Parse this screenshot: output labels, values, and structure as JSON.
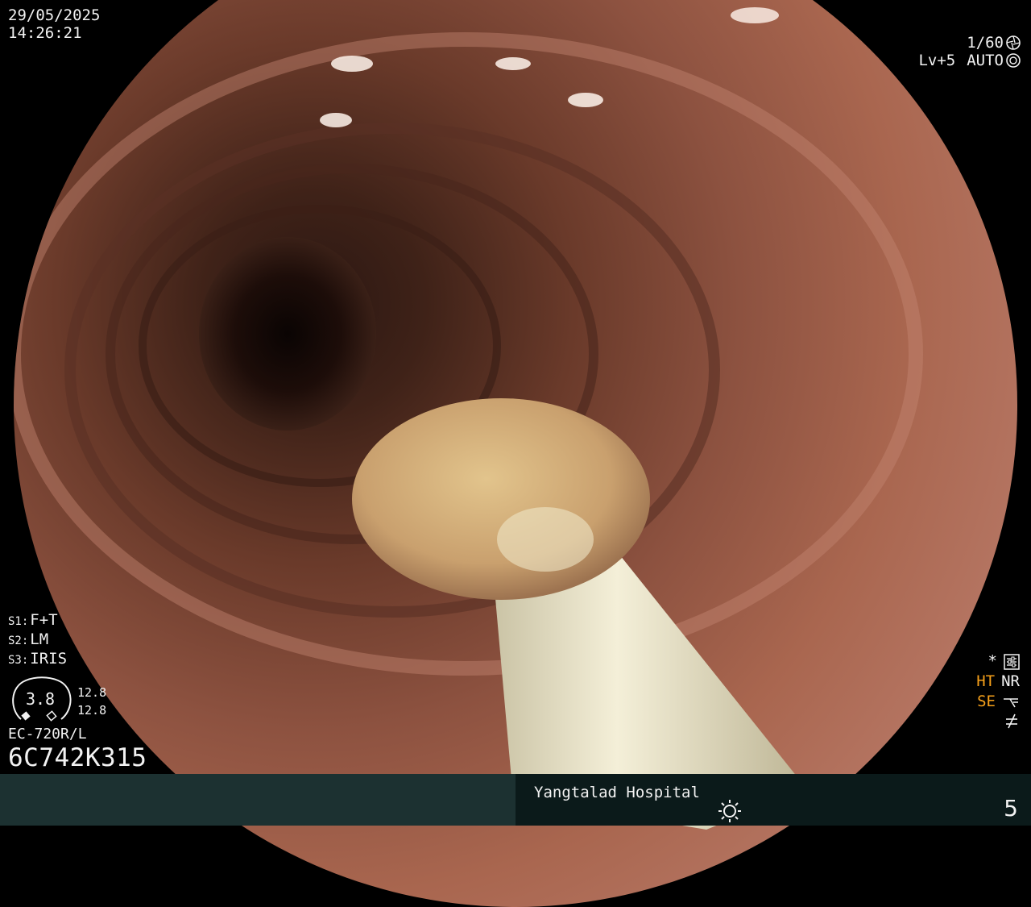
{
  "overlay": {
    "date": "29/05/2025",
    "time": "14:26:21",
    "shutter": "1/60",
    "level": "Lv+5",
    "mode": "AUTO"
  },
  "settings": [
    {
      "key": "S1:",
      "value": "F+T"
    },
    {
      "key": "S2:",
      "value": "LM"
    },
    {
      "key": "S3:",
      "value": "IRIS"
    }
  ],
  "gauge": {
    "center": "3.8",
    "top": "12.8",
    "bottom": "12.8"
  },
  "scope": {
    "model": "EC-720R/L",
    "serial": "6C742K315"
  },
  "status_icons": {
    "star": "*",
    "ht": "HT",
    "nr": "NR",
    "se": "SE"
  },
  "footer": {
    "hospital": "Yangtalad Hospital",
    "page": "5"
  },
  "colors": {
    "orange": "#f6a01a",
    "bar": "#0b1a1a",
    "bar_left": "#1c3131"
  }
}
